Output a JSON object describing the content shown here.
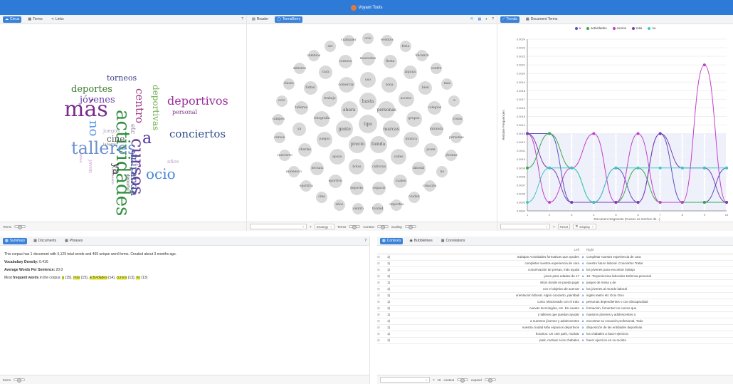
{
  "app": {
    "title": "Voyant Tools"
  },
  "cirrus_panel": {
    "tabs": [
      {
        "label": "Cirrus"
      },
      {
        "label": "Terms"
      },
      {
        "label": "Links"
      }
    ],
    "help": "?",
    "footer_label": "Terms",
    "words": [
      {
        "text": "actividades",
        "color": "#2f8f3e"
      },
      {
        "text": "más",
        "color": "#7a2a8a"
      },
      {
        "text": "talleres",
        "color": "#6b8fd0"
      },
      {
        "text": "deportivos",
        "color": "#9b2f9e"
      },
      {
        "text": "cursos",
        "color": "#6a3b9b"
      },
      {
        "text": "conciertos",
        "color": "#2d4c8a"
      },
      {
        "text": "ocio",
        "color": "#4a86d8"
      },
      {
        "text": "jóvenes",
        "color": "#6b3ea3"
      },
      {
        "text": "deportes",
        "color": "#3e7a2e"
      },
      {
        "text": "torneos",
        "color": "#3a3a8a"
      },
      {
        "text": "centro",
        "color": "#a33a8a"
      },
      {
        "text": "no",
        "color": "#5b9be8"
      },
      {
        "text": "a",
        "color": "#4a2ea3"
      },
      {
        "text": "cine",
        "color": "#555555"
      },
      {
        "text": "miranda",
        "color": "#3e5a9b"
      },
      {
        "text": "ya",
        "color": "#2a2a2a"
      },
      {
        "text": "personal",
        "color": "#7a3a8a"
      },
      {
        "text": "deportivas",
        "color": "#6ab04a"
      },
      {
        "text": "juegos",
        "color": "#b0a0c0"
      },
      {
        "text": "etc",
        "color": "#8a7aa0"
      },
      {
        "text": "años",
        "color": "#c0a0c8"
      },
      {
        "text": "deporte",
        "color": "#4a4a4a"
      },
      {
        "text": "laboral",
        "color": "#6a6a6a"
      },
      {
        "text": "salonesco",
        "color": "#8a6aa0"
      },
      {
        "text": "joven",
        "color": "#caa0d0"
      },
      {
        "text": "fútbol",
        "color": "#b88ac0"
      }
    ]
  },
  "bubbles_panel": {
    "tabs": [
      {
        "label": "Reader"
      },
      {
        "label": "TermsBerry"
      }
    ],
    "help": "?",
    "footer": {
      "strategy": "Strategy",
      "terms": "Terms",
      "context": "Context",
      "scaling": "Scaling"
    },
    "terms": [
      "tipo",
      "hasta",
      "personas",
      "marcas",
      "tienda",
      "precio",
      "gente",
      "ahora",
      "uso",
      "zona",
      "acceso",
      "grupos",
      "música",
      "calles",
      "culturas",
      "bolas",
      "apoyo",
      "juegos",
      "fotografía",
      "trabajo",
      "comercial",
      "musicales",
      "fiesta",
      "alguna",
      "bien",
      "colegios",
      "miranda",
      "joven",
      "laboral",
      "cuales",
      "espacio",
      "deporte",
      "eportivo",
      "lectura",
      "charlas",
      "ya",
      "talleres",
      "fútbol",
      "cara",
      "torneos",
      "ocio",
      "eventos",
      "feria",
      "folcanch",
      "centro",
      "más",
      "a",
      "cosas",
      "personas",
      "jóvenes",
      "no",
      "creación",
      "ciudad",
      "deportes",
      "tividad",
      "centro",
      "años",
      "cine",
      "eportiva",
      "salonesco",
      "concierto",
      "cursos",
      "campos",
      "ocio",
      "clases",
      "deberes",
      "cambios",
      "ser",
      "cualquier"
    ]
  },
  "trends_panel": {
    "tabs": [
      {
        "label": "Trends"
      },
      {
        "label": "Document Terms"
      }
    ],
    "legend": [
      {
        "name": "a",
        "color": "#5b4fbf"
      },
      {
        "name": "actividades",
        "color": "#3aa84a"
      },
      {
        "name": "cursos",
        "color": "#c23fc9"
      },
      {
        "name": "más",
        "color": "#7a3fb0"
      },
      {
        "name": "no",
        "color": "#3ec9c2"
      }
    ],
    "ylabel": "Relative Frequencies",
    "xlabel": "Document Segments (Cursos es menhor de...)",
    "yticks": [
      "0.0024",
      "0.0023",
      "0.0022",
      "0.0021",
      "0.0020",
      "0.0019",
      "0.0018",
      "0.0017",
      "0.0016",
      "0.0015",
      "0.0014",
      "0.0013",
      "0.0012",
      "0.0011",
      "0.0010",
      "0.0009",
      "0.0008",
      "0.0007",
      "0.0006",
      "0.0005",
      "0.0004"
    ],
    "xticks": [
      "1",
      "2",
      "3",
      "4",
      "5",
      "6",
      "7",
      "8",
      "9",
      "10"
    ],
    "footer": {
      "reset": "Reset",
      "display": "Display"
    },
    "chart_data": {
      "type": "line",
      "x": [
        1,
        2,
        3,
        4,
        5,
        6,
        7,
        8,
        9,
        10
      ],
      "series": [
        {
          "name": "a",
          "values": [
            0.0013,
            0.0013,
            0.0005,
            0.0005,
            0.0009,
            0.0005,
            0.0013,
            0.0005,
            0.0005,
            0.0009
          ]
        },
        {
          "name": "actividades",
          "values": [
            0.0009,
            0.0013,
            0.0009,
            0.0005,
            0.0005,
            0.0009,
            0.0005,
            0.0005,
            0.0005,
            0.0005
          ]
        },
        {
          "name": "cursos",
          "values": [
            0.0013,
            0.0005,
            0.0009,
            0.0013,
            0.0005,
            0.0013,
            0.0005,
            0.0005,
            0.0021,
            0.0005
          ]
        },
        {
          "name": "más",
          "values": [
            0.0013,
            0.0009,
            0.0005,
            0.0005,
            0.0005,
            0.0005,
            0.0013,
            0.0009,
            0.0009,
            0.0005
          ]
        },
        {
          "name": "no",
          "values": [
            0.0005,
            0.0009,
            0.0009,
            0.0005,
            0.0009,
            0.0009,
            0.0009,
            0.0009,
            0.0009,
            0.0009
          ]
        }
      ]
    }
  },
  "summary_panel": {
    "tabs": [
      {
        "label": "Summary"
      },
      {
        "label": "Documents"
      },
      {
        "label": "Phrases"
      }
    ],
    "help": "?",
    "line1": "This corpus has 1 document with 6,129 total words and 469 unique word forms. Created about 3 months ago.",
    "density_label": "Vocabulary Density:",
    "density_value": "0.416",
    "avg_label": "Average Words Per Sentence:",
    "avg_value": "20.0",
    "freq_prefix": "Most",
    "freq_bold": "frequent words",
    "freq_mid": "in the corpus:",
    "freq_words": [
      {
        "w": "a",
        "c": "(15)"
      },
      {
        "w": "más",
        "c": "(15)"
      },
      {
        "w": "actividades",
        "c": "(14)"
      },
      {
        "w": "cursos",
        "c": "(13)"
      },
      {
        "w": "no",
        "c": "(13)"
      }
    ],
    "footer_label": "Items"
  },
  "contexts_panel": {
    "tabs": [
      {
        "label": "Contexts"
      },
      {
        "label": "Bubblelines"
      },
      {
        "label": "Correlations"
      }
    ],
    "columns": {
      "left": "Left",
      "right": "Right"
    },
    "rows": [
      {
        "doc": "1)",
        "left": "trabajan Actividades formativas que ayuden",
        "term": "a",
        "right": "completar nuestra experiencia de cara"
      },
      {
        "doc": "1)",
        "left": "completar nuestra experiencia de cara",
        "term": "a",
        "right": "nuestro futuro laboral. Conciertos Tratar"
      },
      {
        "doc": "1)",
        "left": "conservación de presas, más ayuda",
        "term": "a",
        "right": "los jóvenes para encontrar trabajo"
      },
      {
        "doc": "1)",
        "left": "joven para edades de 17",
        "term": "a",
        "right": "19. \"Experiencias laborales Defensa personal"
      },
      {
        "doc": "1)",
        "left": "sitios donde se pueda jugar",
        "term": "a",
        "right": "juegos de mesa y de"
      },
      {
        "doc": "1)",
        "left": "con el objetivo de acercar",
        "term": "a",
        "right": "los jóvenes al mundo laboral"
      },
      {
        "doc": "1)",
        "left": "orientación laboral. Algún concierto, paintball",
        "term": "a",
        "right": "ingles teatro etc Ocio Ocio"
      },
      {
        "doc": "1)",
        "left": "curso relacionado con el trato",
        "term": "a",
        "right": "personas dependientes o con discapacidad"
      },
      {
        "doc": "1)",
        "left": "nuevas tecnologías, etc. En cuanto",
        "term": "a",
        "right": "formación, fomentar los cursos que"
      },
      {
        "doc": "1)",
        "left": "y talleres que puedan ayudar",
        "term": "a",
        "right": "nuestros jóvenes y adolescentes a"
      },
      {
        "doc": "1)",
        "left": "a nuestros jóvenes y adolescentes",
        "term": "a",
        "right": "encontrar su vocación profesional. Todo"
      },
      {
        "doc": "1)",
        "left": "nuestra ciudad Más espacios deportivos",
        "term": "a",
        "right": "disposición de las entidades deportivas"
      },
      {
        "doc": "1)",
        "left": "horarios. Un cine park, motivar",
        "term": "a",
        "right": "los chabales a hacer ejercicio"
      },
      {
        "doc": "1)",
        "left": "park, motivar a los chabales",
        "term": "a",
        "right": "hacer ejercicio en su recinto"
      }
    ],
    "footer": {
      "count": "15",
      "context": "context",
      "expand": "expand"
    }
  }
}
